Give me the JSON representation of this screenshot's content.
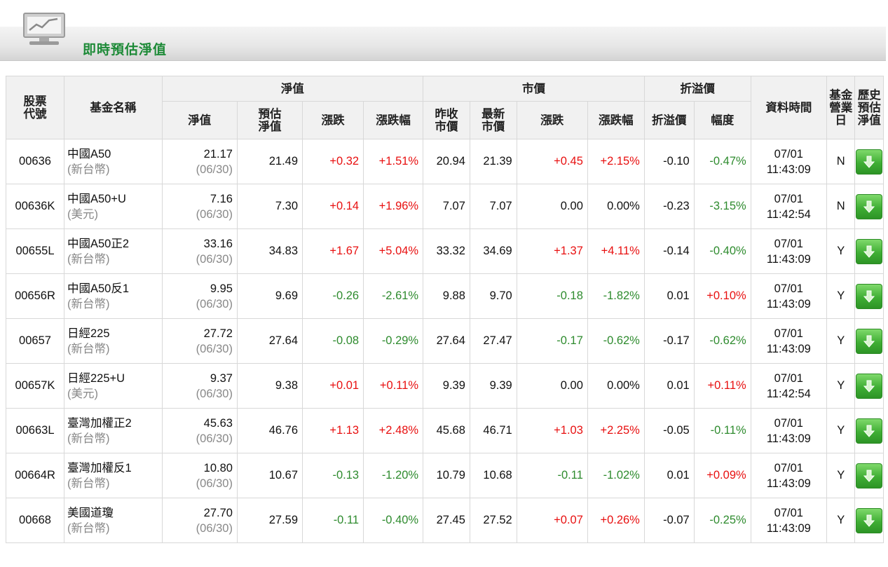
{
  "header": {
    "title": "即時預估淨值",
    "icon": "line-chart-monitor-icon"
  },
  "columns": {
    "code": "股票代號",
    "name": "基金名稱",
    "nav_group": "淨值",
    "nav": "淨值",
    "est_nav": "預估淨值",
    "nav_change": "漲跌",
    "nav_change_pct": "漲跌幅",
    "market_group": "市價",
    "prev_close": "昨收市價",
    "last_price": "最新市價",
    "mkt_change": "漲跌",
    "mkt_change_pct": "漲跌幅",
    "premium_group": "折溢價",
    "premium": "折溢價",
    "premium_pct": "幅度",
    "time": "資料時間",
    "open_day": "基金營業日",
    "history": "歷史預估淨值"
  },
  "colors": {
    "up": "#e81010",
    "down": "#2e8b2e",
    "title": "#1d8a37",
    "button": "#3fae34"
  },
  "rows": [
    {
      "code": "00636",
      "name": "中國A50",
      "currency": "(新台幣)",
      "nav": "21.17",
      "nav_date": "(06/30)",
      "est_nav": "21.49",
      "nav_change": "+0.32",
      "nav_change_pct": "+1.51%",
      "nav_dir": "up",
      "prev_close": "20.94",
      "last_price": "21.39",
      "mkt_change": "+0.45",
      "mkt_change_pct": "+2.15%",
      "mkt_dir": "up",
      "premium": "-0.10",
      "premium_pct": "-0.47%",
      "prem_dir": "dn",
      "date": "07/01",
      "time": "11:43:09",
      "open_day": "N"
    },
    {
      "code": "00636K",
      "name": "中國A50+U",
      "currency": "(美元)",
      "nav": "7.16",
      "nav_date": "(06/30)",
      "est_nav": "7.30",
      "nav_change": "+0.14",
      "nav_change_pct": "+1.96%",
      "nav_dir": "up",
      "prev_close": "7.07",
      "last_price": "7.07",
      "mkt_change": "0.00",
      "mkt_change_pct": "0.00%",
      "mkt_dir": "flat",
      "premium": "-0.23",
      "premium_pct": "-3.15%",
      "prem_dir": "dn",
      "date": "07/01",
      "time": "11:42:54",
      "open_day": "N"
    },
    {
      "code": "00655L",
      "name": "中國A50正2",
      "currency": "(新台幣)",
      "nav": "33.16",
      "nav_date": "(06/30)",
      "est_nav": "34.83",
      "nav_change": "+1.67",
      "nav_change_pct": "+5.04%",
      "nav_dir": "up",
      "prev_close": "33.32",
      "last_price": "34.69",
      "mkt_change": "+1.37",
      "mkt_change_pct": "+4.11%",
      "mkt_dir": "up",
      "premium": "-0.14",
      "premium_pct": "-0.40%",
      "prem_dir": "dn",
      "date": "07/01",
      "time": "11:43:09",
      "open_day": "Y"
    },
    {
      "code": "00656R",
      "name": "中國A50反1",
      "currency": "(新台幣)",
      "nav": "9.95",
      "nav_date": "(06/30)",
      "est_nav": "9.69",
      "nav_change": "-0.26",
      "nav_change_pct": "-2.61%",
      "nav_dir": "dn",
      "prev_close": "9.88",
      "last_price": "9.70",
      "mkt_change": "-0.18",
      "mkt_change_pct": "-1.82%",
      "mkt_dir": "dn",
      "premium": "0.01",
      "premium_pct": "+0.10%",
      "prem_dir": "up",
      "date": "07/01",
      "time": "11:43:09",
      "open_day": "Y"
    },
    {
      "code": "00657",
      "name": "日經225",
      "currency": "(新台幣)",
      "nav": "27.72",
      "nav_date": "(06/30)",
      "est_nav": "27.64",
      "nav_change": "-0.08",
      "nav_change_pct": "-0.29%",
      "nav_dir": "dn",
      "prev_close": "27.64",
      "last_price": "27.47",
      "mkt_change": "-0.17",
      "mkt_change_pct": "-0.62%",
      "mkt_dir": "dn",
      "premium": "-0.17",
      "premium_pct": "-0.62%",
      "prem_dir": "dn",
      "date": "07/01",
      "time": "11:43:09",
      "open_day": "Y"
    },
    {
      "code": "00657K",
      "name": "日經225+U",
      "currency": "(美元)",
      "nav": "9.37",
      "nav_date": "(06/30)",
      "est_nav": "9.38",
      "nav_change": "+0.01",
      "nav_change_pct": "+0.11%",
      "nav_dir": "up",
      "prev_close": "9.39",
      "last_price": "9.39",
      "mkt_change": "0.00",
      "mkt_change_pct": "0.00%",
      "mkt_dir": "flat",
      "premium": "0.01",
      "premium_pct": "+0.11%",
      "prem_dir": "up",
      "date": "07/01",
      "time": "11:42:54",
      "open_day": "Y"
    },
    {
      "code": "00663L",
      "name": "臺灣加權正2",
      "currency": "(新台幣)",
      "nav": "45.63",
      "nav_date": "(06/30)",
      "est_nav": "46.76",
      "nav_change": "+1.13",
      "nav_change_pct": "+2.48%",
      "nav_dir": "up",
      "prev_close": "45.68",
      "last_price": "46.71",
      "mkt_change": "+1.03",
      "mkt_change_pct": "+2.25%",
      "mkt_dir": "up",
      "premium": "-0.05",
      "premium_pct": "-0.11%",
      "prem_dir": "dn",
      "date": "07/01",
      "time": "11:43:09",
      "open_day": "Y"
    },
    {
      "code": "00664R",
      "name": "臺灣加權反1",
      "currency": "(新台幣)",
      "nav": "10.80",
      "nav_date": "(06/30)",
      "est_nav": "10.67",
      "nav_change": "-0.13",
      "nav_change_pct": "-1.20%",
      "nav_dir": "dn",
      "prev_close": "10.79",
      "last_price": "10.68",
      "mkt_change": "-0.11",
      "mkt_change_pct": "-1.02%",
      "mkt_dir": "dn",
      "premium": "0.01",
      "premium_pct": "+0.09%",
      "prem_dir": "up",
      "date": "07/01",
      "time": "11:43:09",
      "open_day": "Y"
    },
    {
      "code": "00668",
      "name": "美國道瓊",
      "currency": "(新台幣)",
      "nav": "27.70",
      "nav_date": "(06/30)",
      "est_nav": "27.59",
      "nav_change": "-0.11",
      "nav_change_pct": "-0.40%",
      "nav_dir": "dn",
      "prev_close": "27.45",
      "last_price": "27.52",
      "mkt_change": "+0.07",
      "mkt_change_pct": "+0.26%",
      "mkt_dir": "up",
      "premium": "-0.07",
      "premium_pct": "-0.25%",
      "prem_dir": "dn",
      "date": "07/01",
      "time": "11:43:09",
      "open_day": "Y"
    }
  ]
}
